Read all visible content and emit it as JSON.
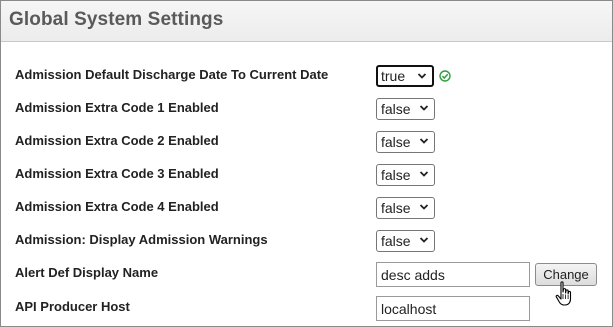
{
  "header": {
    "title": "Global System Settings"
  },
  "settings": [
    {
      "label": "Admission Default Discharge Date To Current Date",
      "value": "true"
    },
    {
      "label": "Admission Extra Code 1 Enabled",
      "value": "false"
    },
    {
      "label": "Admission Extra Code 2 Enabled",
      "value": "false"
    },
    {
      "label": "Admission Extra Code 3 Enabled",
      "value": "false"
    },
    {
      "label": "Admission Extra Code 4 Enabled",
      "value": "false"
    },
    {
      "label": "Admission: Display Admission Warnings",
      "value": "false"
    }
  ],
  "alert_def": {
    "label": "Alert Def Display Name",
    "value": "desc adds",
    "button": "Change"
  },
  "api_host": {
    "label": "API Producer Host",
    "value": "localhost"
  },
  "icons": {
    "saved": "check-circle-icon",
    "pointer": "hand-pointer-icon"
  },
  "colors": {
    "saved_check": "#2e9e3e",
    "header_bg": "#efefef",
    "title_text": "#5a5a5a"
  }
}
